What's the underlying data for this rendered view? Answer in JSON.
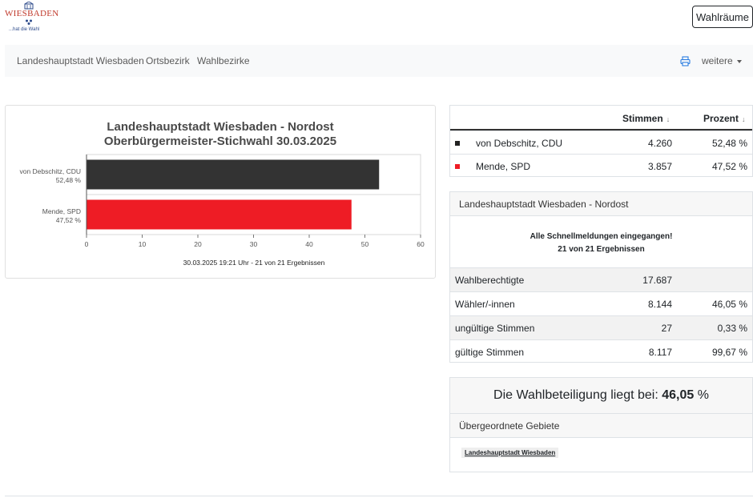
{
  "header": {
    "logo_text": "WIESBADEN",
    "logo_tagline": "...hat die Wahl",
    "wahlraeume_label": "Wahlräume"
  },
  "nav": {
    "items": [
      "Landeshauptstadt Wiesbaden",
      "Ortsbezirk",
      "Wahlbezirke"
    ],
    "more_label": "weitere",
    "print_icon": "printer-icon"
  },
  "chart_data": {
    "type": "bar",
    "orientation": "horizontal",
    "title": "Landeshauptstadt Wiesbaden - Nordost",
    "subtitle": "Oberbürgermeister-Stichwahl 30.03.2025",
    "categories": [
      "von Debschitz, CDU",
      "Mende, SPD"
    ],
    "category_labels_pct": [
      "52,48 %",
      "47,52 %"
    ],
    "values": [
      52.48,
      47.52
    ],
    "colors": [
      "#333333",
      "#ee1c25"
    ],
    "xlim": [
      0,
      60
    ],
    "xticks": [
      0,
      10,
      20,
      30,
      40,
      50,
      60
    ],
    "footer": "30.03.2025 19:21 Uhr - 21 von 21 Ergebnissen",
    "grid": true
  },
  "results": {
    "col_votes": "Stimmen",
    "col_percent": "Prozent",
    "sort_symbol": "↓",
    "rows": [
      {
        "name": "von Debschitz, CDU",
        "votes": "4.260",
        "percent": "52,48 %",
        "color": "#222222"
      },
      {
        "name": "Mende, SPD",
        "votes": "3.857",
        "percent": "47,52 %",
        "color": "#ee1c25"
      }
    ]
  },
  "summary": {
    "title": "Landeshauptstadt Wiesbaden - Nordost",
    "notice_line1": "Alle Schnellmeldungen eingegangen!",
    "notice_line2": "21 von 21 Ergebnissen",
    "rows": [
      {
        "label": "Wahlberechtigte",
        "value": "17.687",
        "percent": ""
      },
      {
        "label": "Wähler/-innen",
        "value": "8.144",
        "percent": "46,05 %"
      },
      {
        "label": "ungültige Stimmen",
        "value": "27",
        "percent": "0,33 %"
      },
      {
        "label": "gültige Stimmen",
        "value": "8.117",
        "percent": "99,67 %"
      }
    ]
  },
  "turnout": {
    "prefix": "Die Wahlbeteiligung liegt bei:",
    "value": "46,05",
    "suffix": "%"
  },
  "parent": {
    "title": "Übergeordnete Gebiete",
    "link": "Landeshauptstadt Wiesbaden"
  }
}
